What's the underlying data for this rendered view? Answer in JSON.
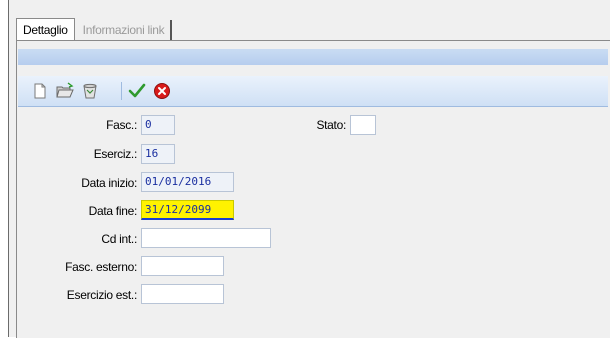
{
  "tabs": [
    {
      "label": "Dettaglio",
      "active": true
    },
    {
      "label": "Informazioni link",
      "active": false
    }
  ],
  "toolbar": {
    "new_icon": "new-document-icon",
    "open_icon": "open-folder-icon",
    "delete_icon": "recycle-bin-icon",
    "confirm_icon": "green-check-icon",
    "cancel_icon": "red-cancel-icon"
  },
  "form": {
    "fasc_label": "Fasc.:",
    "fasc_value": "0",
    "stato_label": "Stato:",
    "stato_value": "",
    "eserciz_label": "Eserciz.:",
    "eserciz_value": "16",
    "data_inizio_label": "Data inizio:",
    "data_inizio_value": "01/01/2016",
    "data_fine_label": "Data fine:",
    "data_fine_value": "31/12/2099",
    "cd_int_label": "Cd int.:",
    "cd_int_value": "",
    "fasc_esterno_label": "Fasc. esterno:",
    "fasc_esterno_value": "",
    "esercizio_est_label": "Esercizio est.:",
    "esercizio_est_value": ""
  },
  "colors": {
    "highlight": "#fff200",
    "accent_blue": "#b6cdee",
    "field_text": "#1a2fa0"
  }
}
